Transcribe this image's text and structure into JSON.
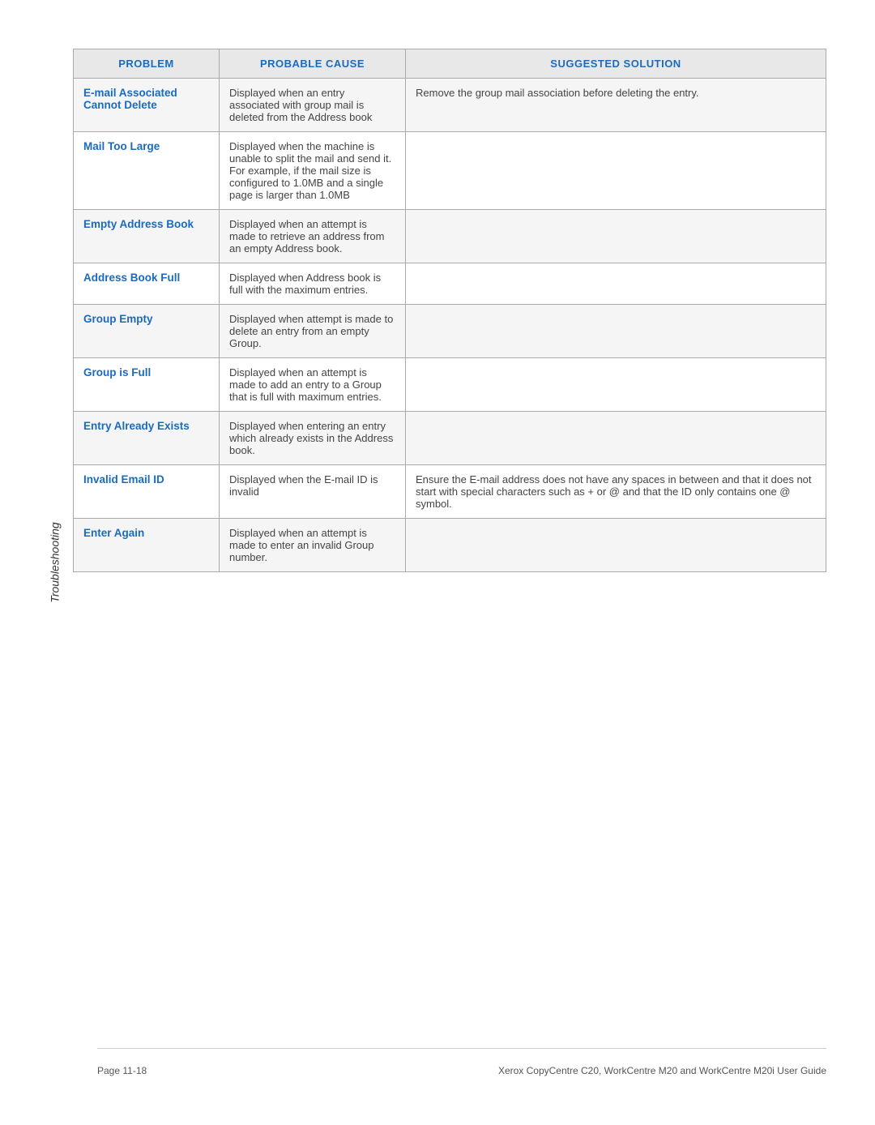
{
  "sidebar": {
    "label": "Troubleshooting"
  },
  "table": {
    "headers": {
      "problem": "PROBLEM",
      "cause": "PROBABLE CAUSE",
      "solution": "SUGGESTED SOLUTION"
    },
    "rows": [
      {
        "problem": "E-mail Associated Cannot Delete",
        "cause": "Displayed when an entry associated with group mail is deleted from the Address book",
        "solution": "Remove the group mail association before deleting the entry."
      },
      {
        "problem": "Mail Too Large",
        "cause": "Displayed when the machine is unable to split the mail and send it. For example, if the mail size is configured to 1.0MB and a single page is larger than 1.0MB",
        "solution": ""
      },
      {
        "problem": "Empty Address Book",
        "cause": "Displayed when an attempt is made to retrieve an address from an empty Address book.",
        "solution": ""
      },
      {
        "problem": "Address Book Full",
        "cause": "Displayed when Address book is full with the maximum entries.",
        "solution": ""
      },
      {
        "problem": "Group Empty",
        "cause": "Displayed when attempt is made to delete an entry from an empty Group.",
        "solution": ""
      },
      {
        "problem": "Group is Full",
        "cause": "Displayed when an attempt is made to add an entry to a Group that is full with maximum entries.",
        "solution": ""
      },
      {
        "problem": "Entry Already Exists",
        "cause": "Displayed when entering an entry which already exists in the Address book.",
        "solution": ""
      },
      {
        "problem": "Invalid Email ID",
        "cause": "Displayed when the E-mail ID is invalid",
        "solution": "Ensure the E-mail address does not have any spaces in between and that it does not start with special characters such as + or @ and that the ID only contains one @ symbol."
      },
      {
        "problem": "Enter Again",
        "cause": "Displayed when an attempt is made to enter an invalid Group number.",
        "solution": ""
      }
    ]
  },
  "footer": {
    "page": "Page 11-18",
    "guide": "Xerox CopyCentre C20, WorkCentre M20 and WorkCentre M20i User Guide"
  }
}
